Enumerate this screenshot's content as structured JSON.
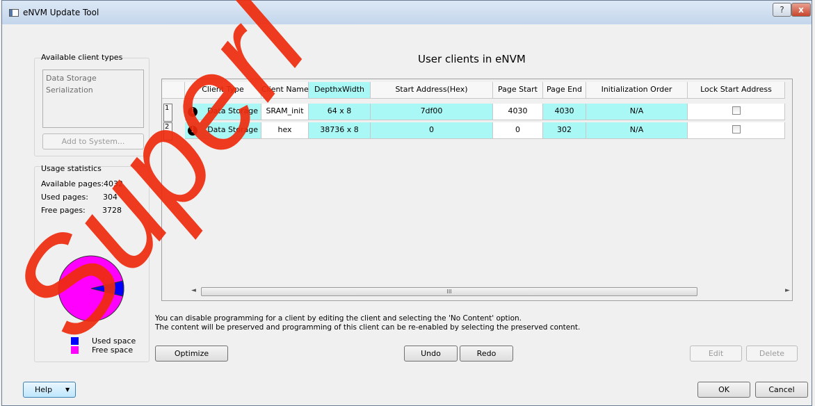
{
  "window": {
    "title": "eNVM Update Tool",
    "help_glyph": "?",
    "close_glyph": "x"
  },
  "left_panel": {
    "client_types_label": "Available client types",
    "client_types": [
      "Data Storage",
      "Serialization"
    ],
    "add_button": "Add to System...",
    "usage_label": "Usage statistics",
    "stats": [
      {
        "label": "Available pages:",
        "value": "4032"
      },
      {
        "label": "Used pages:",
        "value": "304"
      },
      {
        "label": "Free pages:",
        "value": "3728"
      }
    ],
    "pie": {
      "used_fraction": 0.0754,
      "used_color": "#0000ff",
      "free_color": "#ff00ff"
    },
    "legend": [
      {
        "label": "Used space",
        "color": "#0000ff"
      },
      {
        "label": "Free space",
        "color": "#ff00ff"
      }
    ]
  },
  "main": {
    "heading": "User clients in eNVM",
    "columns": [
      "Client Type",
      "Client Name",
      "DepthxWidth",
      "Start Address(Hex)",
      "Page Start",
      "Page End",
      "Initialization Order",
      "Lock Start Address"
    ],
    "rows": [
      {
        "num": "1",
        "type": "Data Storage",
        "name": "SRAM_init",
        "depth": "64 x 8",
        "start_addr": "7df00",
        "page_start": "4030",
        "page_end": "4030",
        "init_order": "N/A",
        "lock": false
      },
      {
        "num": "2",
        "type": "Data Storage",
        "name": "hex",
        "depth": "38736 x 8",
        "start_addr": "0",
        "page_start": "0",
        "page_end": "302",
        "init_order": "N/A",
        "lock": false
      }
    ],
    "scroll_left": "◄",
    "scroll_grip": "III",
    "scroll_right": "►",
    "note_line1": "You can disable programming for a client by editing the client and selecting the 'No Content' option.",
    "note_line2": "The content will be preserved and programming of this client can be re-enabled by selecting the preserved content."
  },
  "buttons": {
    "optimize": "Optimize",
    "undo": "Undo",
    "redo": "Redo",
    "edit": "Edit",
    "delete": "Delete",
    "help": "Help",
    "help_arrow": "▼",
    "ok": "OK",
    "cancel": "Cancel"
  },
  "watermark": "Superl"
}
